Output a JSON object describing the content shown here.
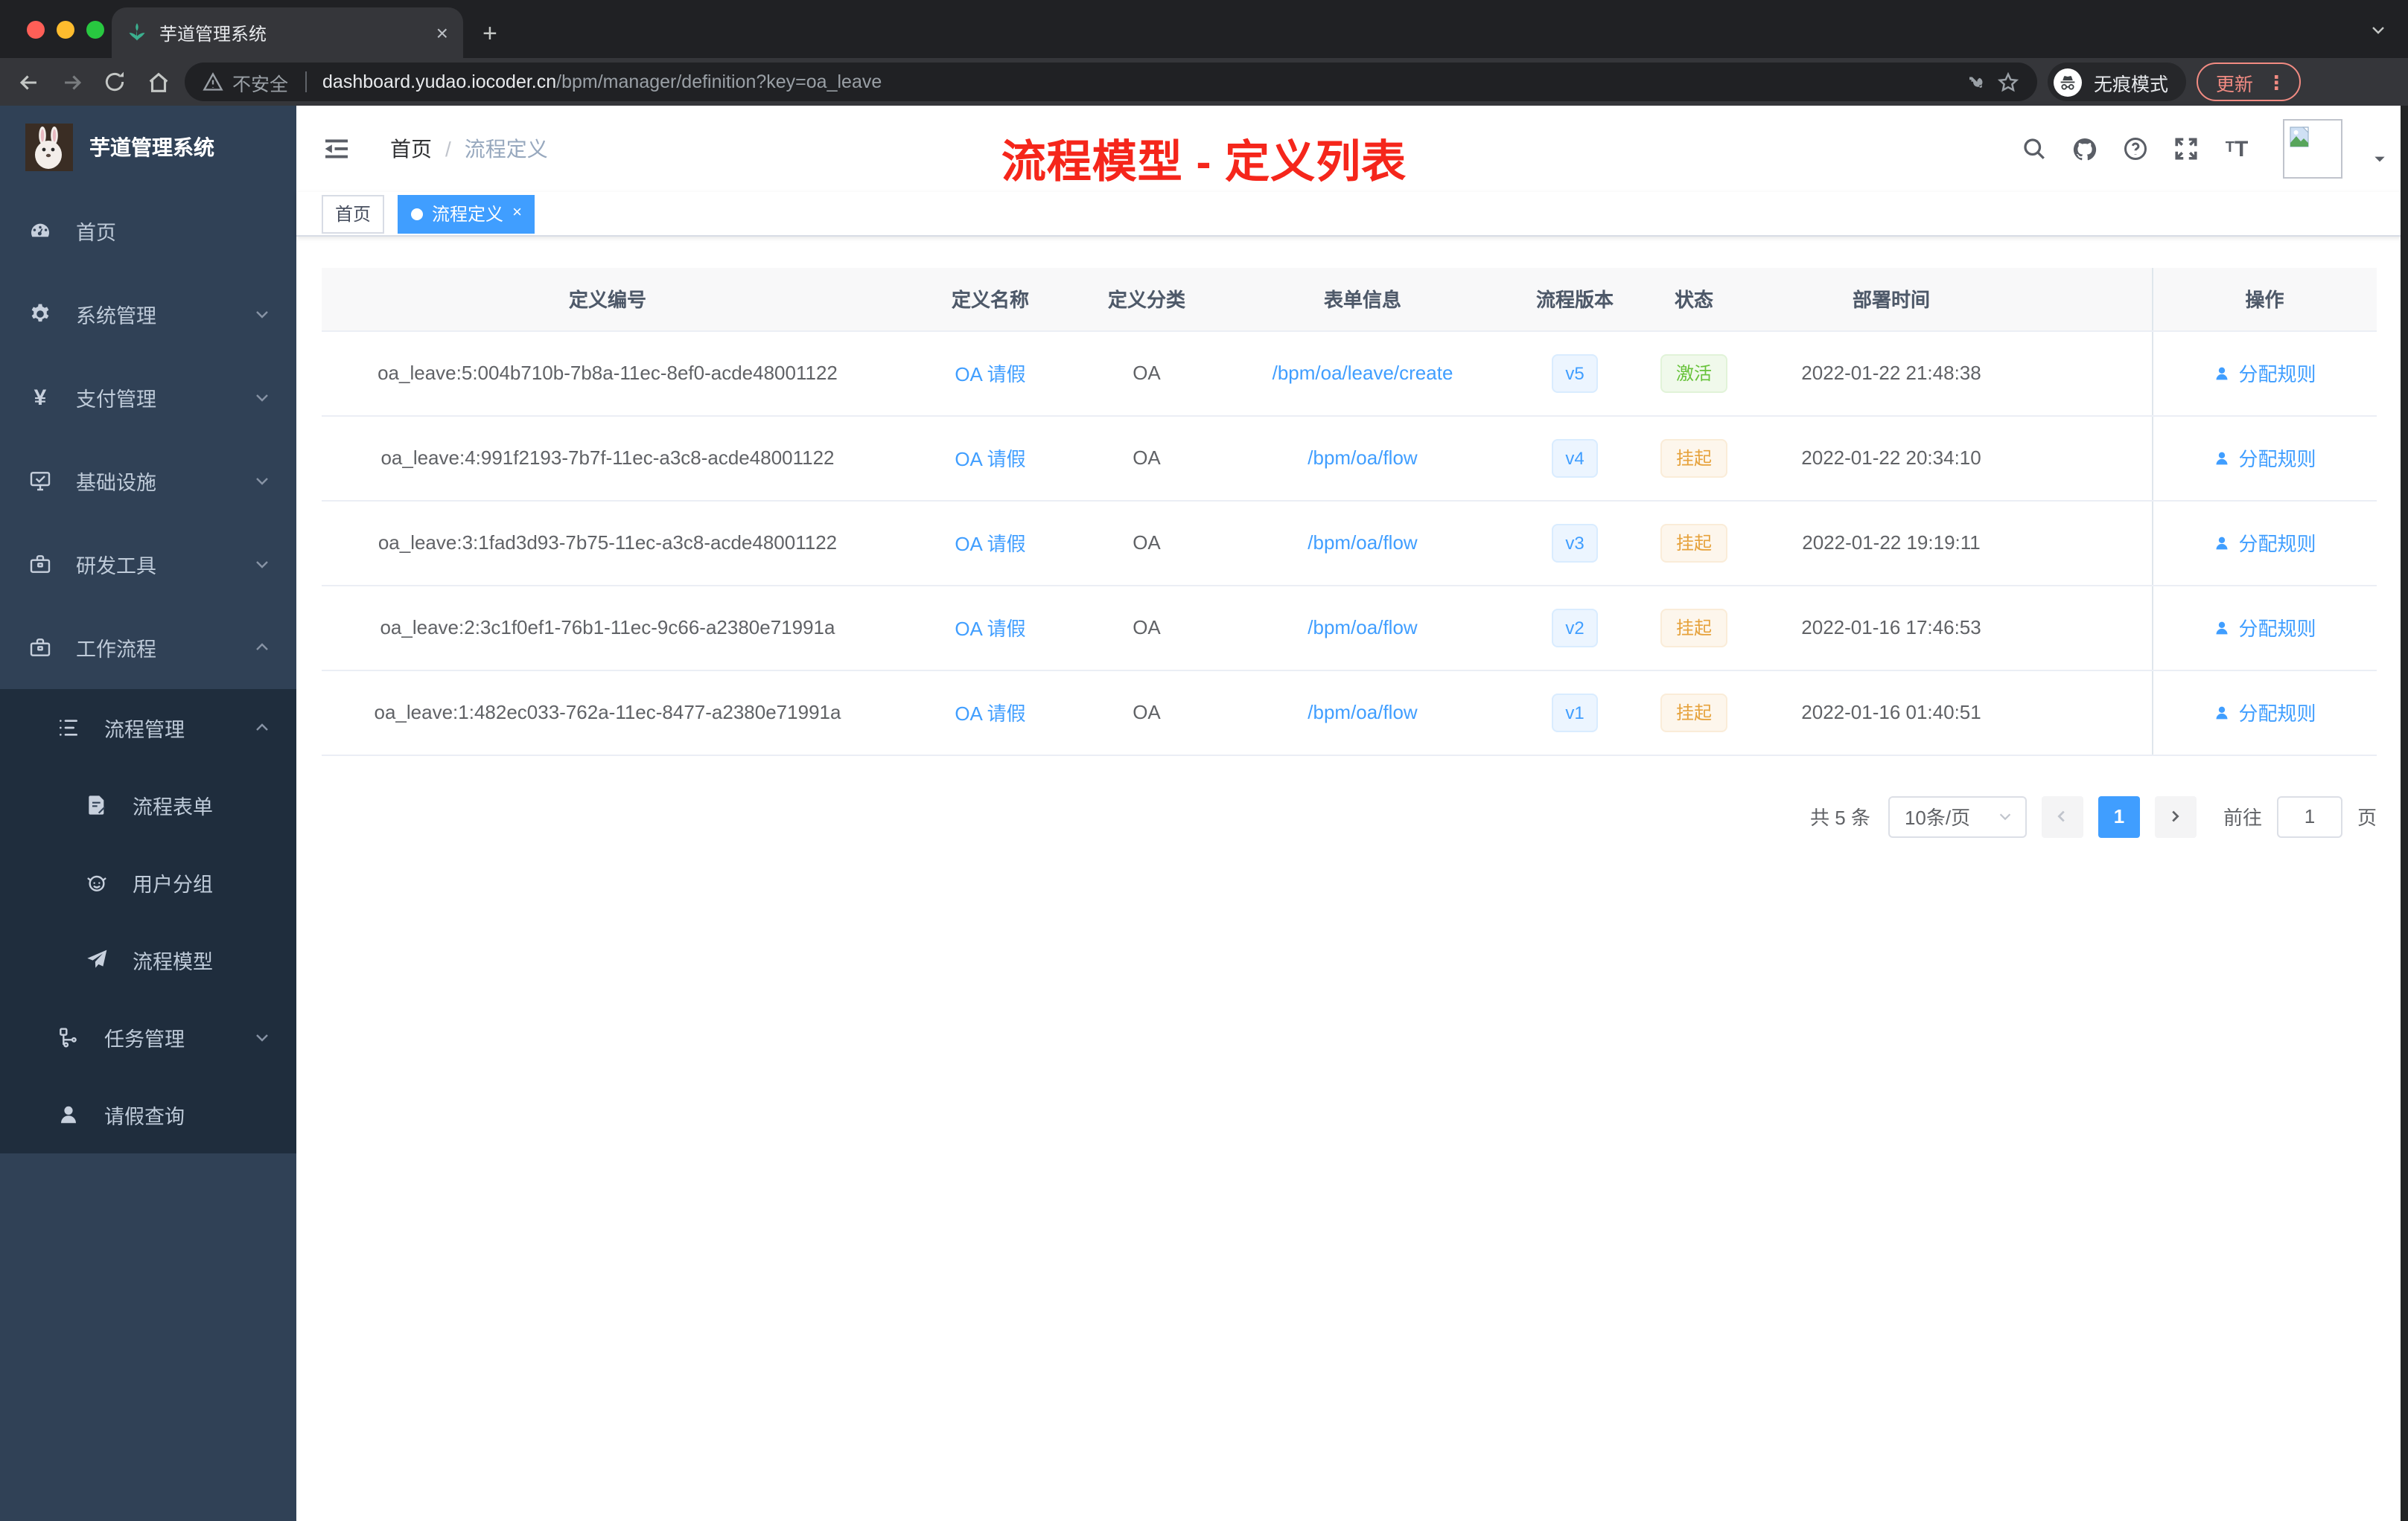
{
  "browser": {
    "tab_title": "芋道管理系统",
    "close_tab": "×",
    "new_tab": "+",
    "security_label": "不安全",
    "url_domain": "dashboard.yudao.iocoder.cn",
    "url_path": "/bpm/manager/definition?key=oa_leave",
    "incognito_label": "无痕模式",
    "update_label": "更新"
  },
  "sidebar": {
    "logo_title": "芋道管理系统",
    "items": [
      {
        "label": "首页",
        "icon": "dashboard-icon",
        "chevron": ""
      },
      {
        "label": "系统管理",
        "icon": "gear-icon",
        "chevron": "down"
      },
      {
        "label": "支付管理",
        "icon": "yen-icon",
        "chevron": "down"
      },
      {
        "label": "基础设施",
        "icon": "monitor-icon",
        "chevron": "down"
      },
      {
        "label": "研发工具",
        "icon": "toolbox-icon",
        "chevron": "down"
      },
      {
        "label": "工作流程",
        "icon": "briefcase-icon",
        "chevron": "up"
      },
      {
        "label": "流程管理",
        "icon": "tree-table-icon",
        "chevron": "up"
      },
      {
        "label": "流程表单",
        "icon": "form-icon",
        "chevron": ""
      },
      {
        "label": "用户分组",
        "icon": "user-group-icon",
        "chevron": ""
      },
      {
        "label": "流程模型",
        "icon": "paper-plane-icon",
        "chevron": ""
      },
      {
        "label": "任务管理",
        "icon": "org-tree-icon",
        "chevron": "down"
      },
      {
        "label": "请假查询",
        "icon": "user-icon",
        "chevron": ""
      }
    ]
  },
  "navbar": {
    "breadcrumb": {
      "home": "首页",
      "separator": "/",
      "current": "流程定义"
    },
    "annotation": "流程模型 - 定义列表",
    "icons": [
      "search-icon",
      "github-icon",
      "help-icon",
      "fullscreen-icon",
      "font-size-icon"
    ]
  },
  "tags": {
    "home": "首页",
    "active": "流程定义"
  },
  "table": {
    "columns": [
      "定义编号",
      "定义名称",
      "定义分类",
      "表单信息",
      "流程版本",
      "状态",
      "部署时间",
      "操作"
    ],
    "action_label": "分配规则",
    "rows": [
      {
        "id": "oa_leave:5:004b710b-7b8a-11ec-8ef0-acde48001122",
        "name": "OA 请假",
        "category": "OA",
        "form": "/bpm/oa/leave/create",
        "version": "v5",
        "status": "激活",
        "deploy_time": "2022-01-22 21:48:38"
      },
      {
        "id": "oa_leave:4:991f2193-7b7f-11ec-a3c8-acde48001122",
        "name": "OA 请假",
        "category": "OA",
        "form": "/bpm/oa/flow",
        "version": "v4",
        "status": "挂起",
        "deploy_time": "2022-01-22 20:34:10"
      },
      {
        "id": "oa_leave:3:1fad3d93-7b75-11ec-a3c8-acde48001122",
        "name": "OA 请假",
        "category": "OA",
        "form": "/bpm/oa/flow",
        "version": "v3",
        "status": "挂起",
        "deploy_time": "2022-01-22 19:19:11"
      },
      {
        "id": "oa_leave:2:3c1f0ef1-76b1-11ec-9c66-a2380e71991a",
        "name": "OA 请假",
        "category": "OA",
        "form": "/bpm/oa/flow",
        "version": "v2",
        "status": "挂起",
        "deploy_time": "2022-01-16 17:46:53"
      },
      {
        "id": "oa_leave:1:482ec033-762a-11ec-8477-a2380e71991a",
        "name": "OA 请假",
        "category": "OA",
        "form": "/bpm/oa/flow",
        "version": "v1",
        "status": "挂起",
        "deploy_time": "2022-01-16 01:40:51"
      }
    ]
  },
  "pagination": {
    "total": "共 5 条",
    "page_size": "10条/页",
    "current_page": "1",
    "goto": "前往",
    "goto_value": "1",
    "page_unit": "页"
  },
  "colors": {
    "accent_blue": "#409eff",
    "success_green": "#67c23a",
    "warning_orange": "#e6a23c",
    "annotation_red": "#f5261b",
    "sidebar_bg": "#304156",
    "submenu_bg": "#1f2d3d"
  }
}
